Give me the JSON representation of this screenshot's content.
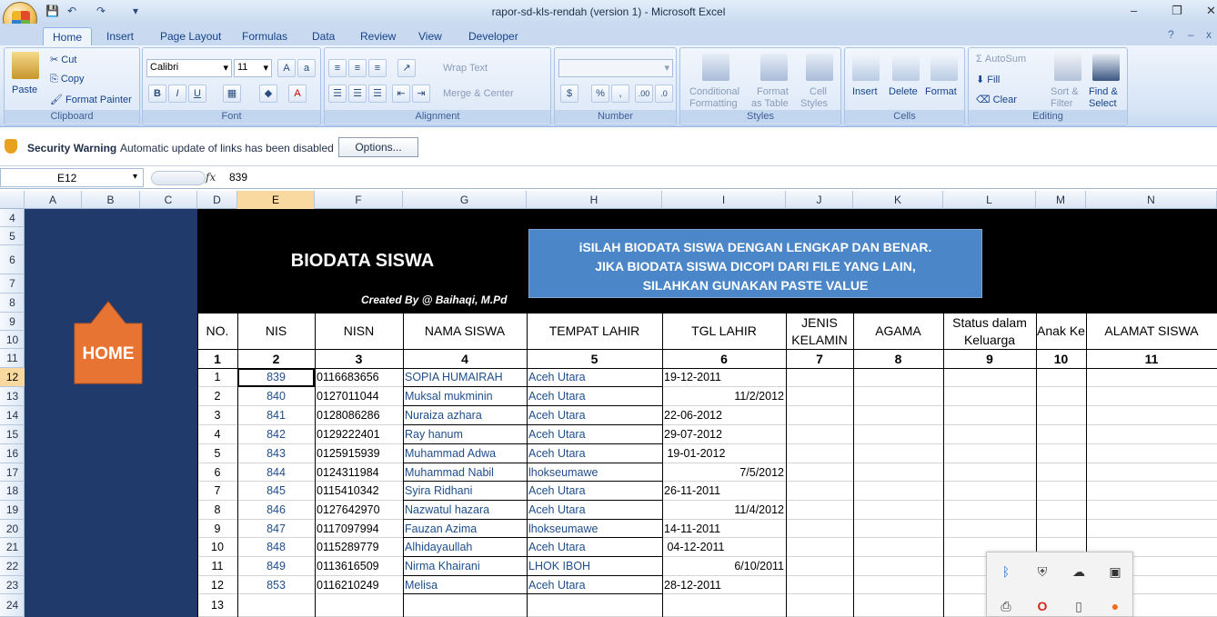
{
  "window": {
    "title": "rapor-sd-kls-rendah (version 1) - Microsoft Excel",
    "controls": [
      "–",
      "❐",
      "✕"
    ],
    "qat": [
      "💾",
      "↶",
      "↷",
      "▾"
    ]
  },
  "ribbon_tabs": [
    "Home",
    "Insert",
    "Page Layout",
    "Formulas",
    "Data",
    "Review",
    "View",
    "Developer"
  ],
  "ribbon": {
    "clipboard": {
      "paste": "Paste",
      "cut": "Cut",
      "copy": "Copy",
      "format_painter": "Format Painter",
      "label": "Clipboard"
    },
    "font": {
      "name": "Calibri",
      "size": "11",
      "label": "Font"
    },
    "alignment": {
      "wrap": "Wrap Text",
      "merge": "Merge & Center",
      "label": "Alignment"
    },
    "number": {
      "label": "Number",
      "currency": "$",
      "percent": "%",
      "comma": ",",
      "inc": ".00",
      "dec": ".0"
    },
    "styles": {
      "cond1": "Conditional",
      "cond2": "Formatting",
      "fmt1": "Format",
      "fmt2": "as Table",
      "cell1": "Cell",
      "cell2": "Styles",
      "label": "Styles"
    },
    "cells": {
      "insert": "Insert",
      "delete": "Delete",
      "format": "Format",
      "label": "Cells"
    },
    "editing": {
      "autosum": "AutoSum",
      "fill": "Fill",
      "clear": "Clear",
      "sort1": "Sort &",
      "sort2": "Filter",
      "find1": "Find &",
      "find2": "Select",
      "label": "Editing"
    }
  },
  "security": {
    "title": "Security Warning",
    "message": "Automatic update of links has been disabled",
    "button": "Options..."
  },
  "formula_bar": {
    "name_box": "E12",
    "fx": "fx",
    "value": "839"
  },
  "columns": [
    "A",
    "B",
    "C",
    "D",
    "E",
    "F",
    "G",
    "H",
    "I",
    "J",
    "K",
    "L",
    "M",
    "N"
  ],
  "selected_column": "E",
  "rows": [
    "4",
    "5",
    "6",
    "7",
    "8",
    "9",
    "10",
    "11",
    "12",
    "13",
    "14",
    "15",
    "16",
    "17",
    "18",
    "19",
    "20",
    "21",
    "22",
    "23",
    "24"
  ],
  "selected_row": "12",
  "sheet": {
    "title": "BIODATA SISWA",
    "created_by": "Created By @ Baihaqi, M.Pd",
    "notice": [
      "iSILAH BIODATA SISWA DENGAN LENGKAP DAN BENAR.",
      "JIKA BIODATA SISWA DICOPI DARI FILE YANG LAIN,",
      "SILAHKAN GUNAKAN PASTE VALUE"
    ],
    "home_button": "HOME",
    "headers": [
      "NO.",
      "NIS",
      "NISN",
      "NAMA SISWA",
      "TEMPAT LAHIR",
      "TGL LAHIR",
      "JENIS KELAMIN",
      "AGAMA",
      "Status dalam Keluarga",
      "Anak Ke",
      "ALAMAT SISWA"
    ],
    "header_numbers": [
      "1",
      "2",
      "3",
      "4",
      "5",
      "6",
      "7",
      "8",
      "9",
      "10",
      "11"
    ],
    "students": [
      {
        "no": "1",
        "nis": "839",
        "nisn": "0116683656",
        "nama": "SOPIA HUMAIRAH",
        "tempat": "Aceh Utara",
        "tgl": "19-12-2011"
      },
      {
        "no": "2",
        "nis": "840",
        "nisn": "0127011044",
        "nama": "Muksal mukminin",
        "tempat": "Aceh Utara",
        "tgl": "11/2/2012"
      },
      {
        "no": "3",
        "nis": "841",
        "nisn": "0128086286",
        "nama": "Nuraiza azhara",
        "tempat": "Aceh Utara",
        "tgl": "22-06-2012"
      },
      {
        "no": "4",
        "nis": "842",
        "nisn": "0129222401",
        "nama": "Ray hanum",
        "tempat": "Aceh Utara",
        "tgl": "29-07-2012"
      },
      {
        "no": "5",
        "nis": "843",
        "nisn": "0125915939",
        "nama": "Muhammad Adwa",
        "tempat": "Aceh Utara",
        "tgl": " 19-01-2012"
      },
      {
        "no": "6",
        "nis": "844",
        "nisn": "0124311984",
        "nama": "Muhammad Nabil",
        "tempat": "lhokseumawe",
        "tgl": "7/5/2012"
      },
      {
        "no": "7",
        "nis": "845",
        "nisn": "0115410342",
        "nama": "Syira Ridhani",
        "tempat": "Aceh Utara",
        "tgl": "26-11-2011"
      },
      {
        "no": "8",
        "nis": "846",
        "nisn": "0127642970",
        "nama": "Nazwatul hazara",
        "tempat": "Aceh Utara",
        "tgl": "11/4/2012"
      },
      {
        "no": "9",
        "nis": "847",
        "nisn": "0117097994",
        "nama": "Fauzan Azima",
        "tempat": "lhokseumawe",
        "tgl": "14-11-2011"
      },
      {
        "no": "10",
        "nis": "848",
        "nisn": "0115289779",
        "nama": "Alhidayaullah",
        "tempat": "Aceh Utara",
        "tgl": " 04-12-2011"
      },
      {
        "no": "11",
        "nis": "849",
        "nisn": "0113616509",
        "nama": "Nirma Khairani",
        "tempat": "LHOK IBOH",
        "tgl": "6/10/2011"
      },
      {
        "no": "12",
        "nis": "853",
        "nisn": "0116210249",
        "nama": "Melisa",
        "tempat": "Aceh Utara",
        "tgl": "28-12-2011"
      },
      {
        "no": "13",
        "nis": "",
        "nisn": "",
        "nama": "",
        "tempat": "",
        "tgl": ""
      }
    ]
  },
  "tray_icons": [
    "bluetooth-icon",
    "shield-icon",
    "cloud-icon",
    "network-icon",
    "printer-icon",
    "opera-icon",
    "usb-icon",
    "avast-icon"
  ],
  "colors": {
    "navy": "#1f3a6b",
    "home_orange": "#e87434",
    "notice_blue": "#4a86c8",
    "link_blue": "#1f4e8c"
  }
}
